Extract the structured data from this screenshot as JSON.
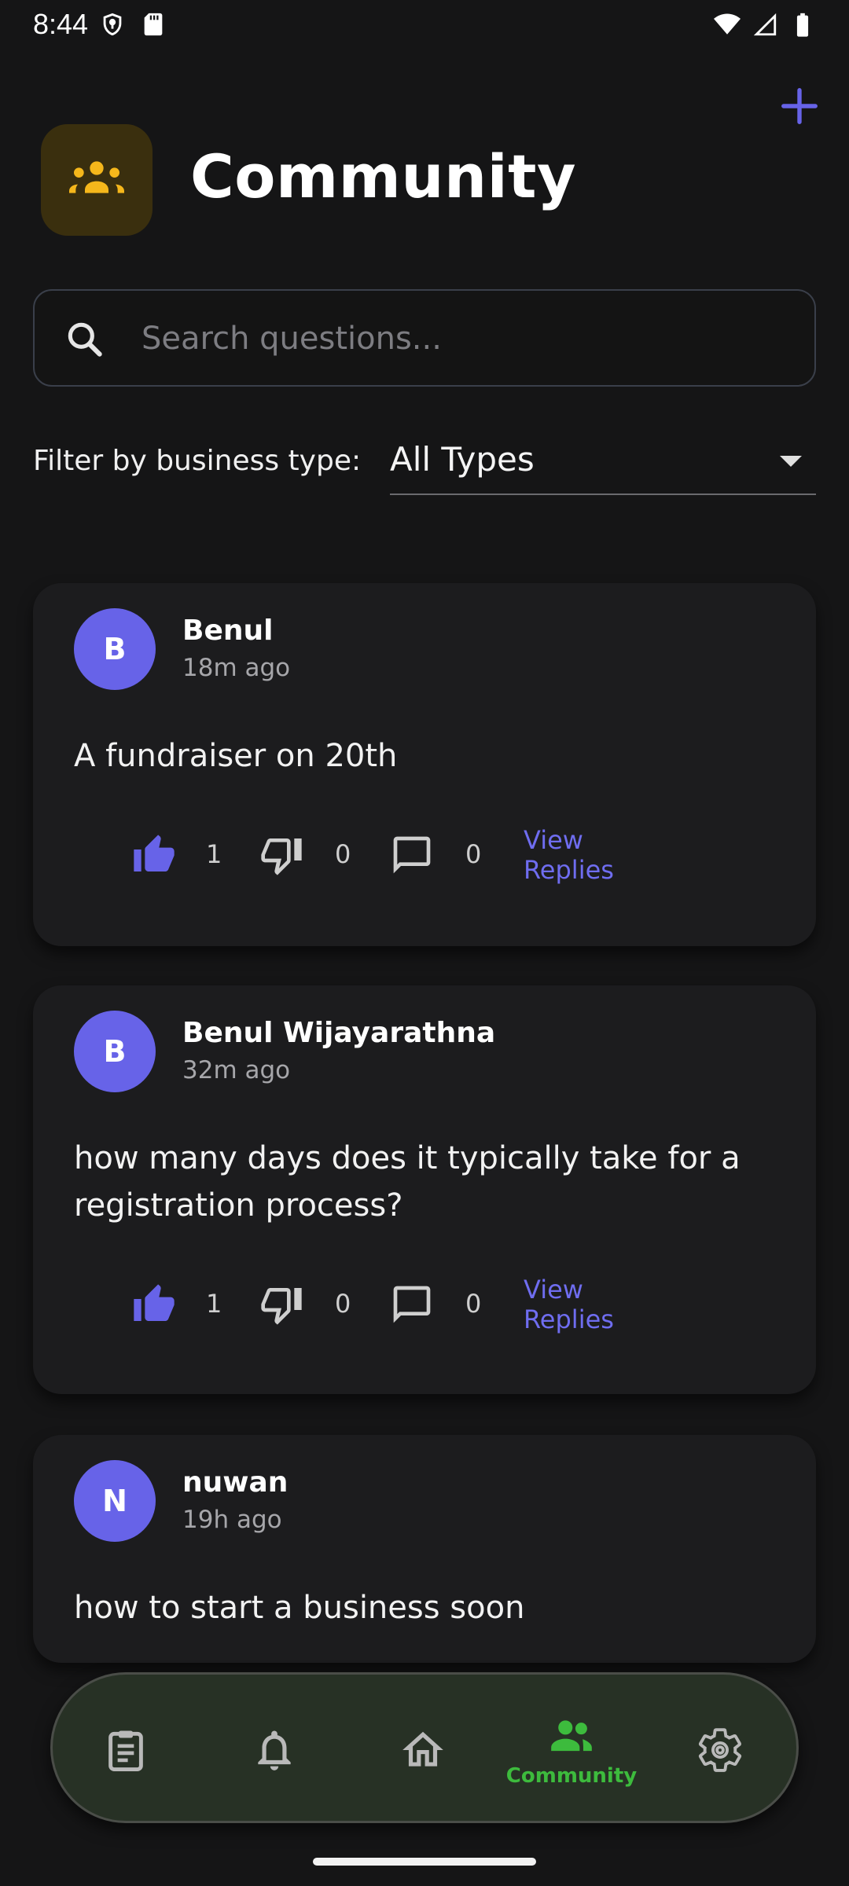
{
  "status_bar": {
    "time": "8:44"
  },
  "header": {
    "title": "Community",
    "add_button_icon": "plus-icon",
    "header_icon": "groups-icon"
  },
  "search": {
    "placeholder": "Search questions...",
    "value": ""
  },
  "filter": {
    "label": "Filter by business type:",
    "selected": "All Types"
  },
  "posts": [
    {
      "avatar_letter": "B",
      "author": "Benul",
      "time": "18m ago",
      "text": "A fundraiser on 20th",
      "likes": "1",
      "dislikes": "0",
      "replies": "0",
      "view_replies": "View Replies"
    },
    {
      "avatar_letter": "B",
      "author": "Benul Wijayarathna",
      "time": "32m ago",
      "text": "how many days does it typically take for a registration process?",
      "likes": "1",
      "dislikes": "0",
      "replies": "0",
      "view_replies": "View Replies"
    },
    {
      "avatar_letter": "N",
      "author": "nuwan",
      "time": "19h ago",
      "text": "how to start a business soon"
    }
  ],
  "bottom_nav": {
    "items": [
      {
        "icon": "clipboard-icon",
        "label": ""
      },
      {
        "icon": "bell-icon",
        "label": ""
      },
      {
        "icon": "home-icon",
        "label": ""
      },
      {
        "icon": "groups-icon",
        "label": "Community",
        "active": true
      },
      {
        "icon": "gear-icon",
        "label": ""
      }
    ]
  },
  "colors": {
    "accent": "#6763e8",
    "active_nav": "#3dbb3d",
    "header_icon_bg": "#3a2f0e",
    "header_icon_fg": "#f5b71b"
  }
}
